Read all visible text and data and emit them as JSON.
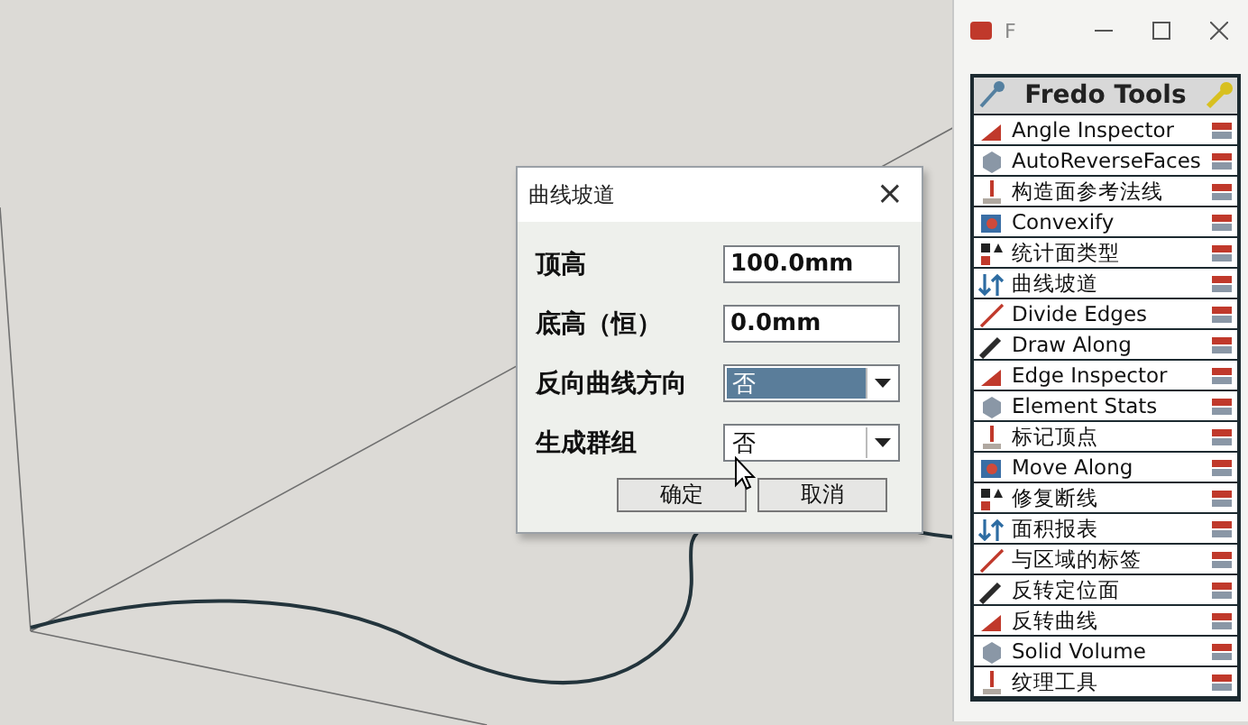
{
  "dialog": {
    "title": "曲线坡道",
    "close": "×",
    "fields": [
      {
        "kind": "text",
        "label": "顶高",
        "value": "100.0mm"
      },
      {
        "kind": "text",
        "label": "底高（恒）",
        "value": "0.0mm"
      },
      {
        "kind": "select",
        "label": "反向曲线方向",
        "value": "否",
        "focused": true
      },
      {
        "kind": "select",
        "label": "生成群组",
        "value": "否",
        "focused": false
      }
    ],
    "buttons": [
      "确定",
      "取消"
    ]
  },
  "toolbar_window": {
    "title": "F",
    "panel": {
      "title": "Fredo Tools",
      "items": [
        {
          "label": "Angle Inspector"
        },
        {
          "label": "AutoReverseFaces"
        },
        {
          "label": "构造面参考法线"
        },
        {
          "label": "Convexify"
        },
        {
          "label": "统计面类型"
        },
        {
          "label": "曲线坡道"
        },
        {
          "label": "Divide Edges"
        },
        {
          "label": "Draw Along"
        },
        {
          "label": "Edge Inspector"
        },
        {
          "label": "Element Stats"
        },
        {
          "label": "标记顶点"
        },
        {
          "label": "Move Along"
        },
        {
          "label": "修复断线"
        },
        {
          "label": "面积报表"
        },
        {
          "label": "与区域的标签"
        },
        {
          "label": "反转定位面"
        },
        {
          "label": "反转曲线"
        },
        {
          "label": "Solid Volume"
        },
        {
          "label": "纹理工具"
        }
      ]
    }
  }
}
